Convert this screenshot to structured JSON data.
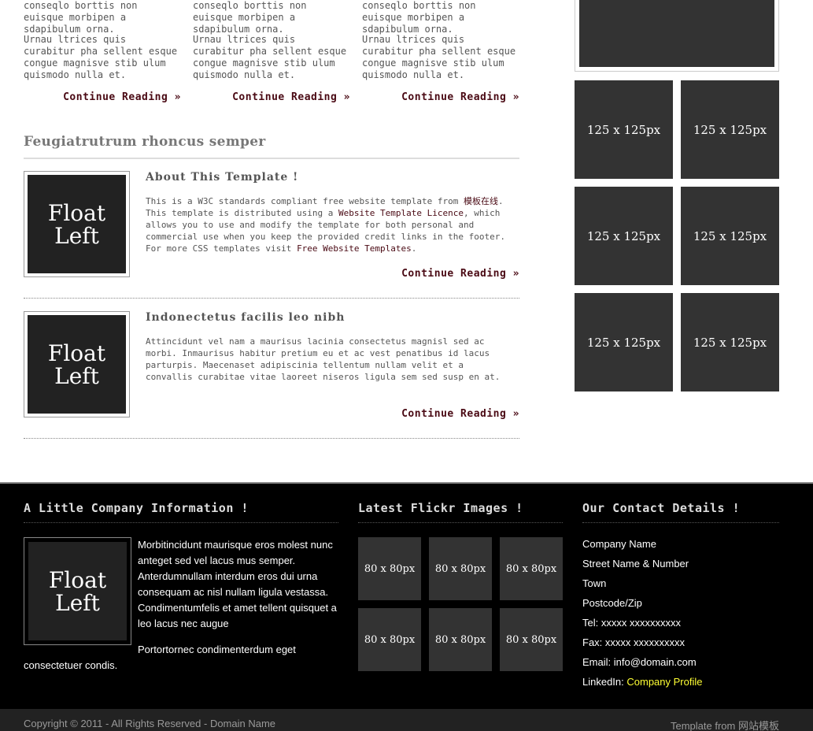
{
  "columns": [
    {
      "p1": "conseqlo borttis non euisque morbipen a sdapibulum orna.",
      "p2": "Urnau ltrices quis curabitur pha sellent esque congue magnisve stib ulum quismodo nulla et.",
      "more": "Continue Reading »"
    },
    {
      "p1": "conseqlo borttis non euisque morbipen a sdapibulum orna.",
      "p2": "Urnau ltrices quis curabitur pha sellent esque congue magnisve stib ulum quismodo nulla et.",
      "more": "Continue Reading »"
    },
    {
      "p1": "conseqlo borttis non euisque morbipen a sdapibulum orna.",
      "p2": "Urnau ltrices quis curabitur pha sellent esque congue magnisve stib ulum quismodo nulla et.",
      "more": "Continue Reading »"
    }
  ],
  "section_title": "Feugiatrutrum rhoncus semper",
  "posts": [
    {
      "thumb_line1": "Float",
      "thumb_line2": "Left",
      "title": "About This Template !",
      "t1": "This is a W3C standards compliant free website template from ",
      "link1": "模板在线",
      "t2": ". This template is distributed using a ",
      "link2": "Website Template Licence",
      "t3": ", which allows you to use and modify the template for both personal and commercial use when you keep the provided credit links in the footer. For more CSS templates visit ",
      "link3": "Free Website Templates",
      "t4": ".",
      "more": "Continue Reading »"
    },
    {
      "thumb_line1": "Float",
      "thumb_line2": "Left",
      "title": "Indonectetus facilis leo nibh",
      "body": "Attincidunt vel nam a maurisus lacinia consectetus magnisl sed ac morbi. Inmaurisus habitur pretium eu et ac vest penatibus id lacus parturpis. Maecenaset adipiscinia tellentum nullam velit et a convallis curabitae vitae laoreet niseros ligula sem sed susp en at.",
      "more": "Continue Reading »"
    }
  ],
  "sidebar": {
    "ads": [
      "125 x 125px",
      "125 x 125px",
      "125 x 125px",
      "125 x 125px",
      "125 x 125px",
      "125 x 125px"
    ]
  },
  "footer": {
    "company": {
      "heading": "A Little Company Information !",
      "thumb_line1": "Float",
      "thumb_line2": "Left",
      "p1": "Morbitincidunt maurisque eros molest nunc anteget sed vel lacus mus semper. Anterdumnullam interdum eros dui urna consequam ac nisl nullam ligula vestassa. Condimentumfelis et amet tellent quisquet a leo lacus nec augue",
      "p2a": "Portortornec condimenterdum eget",
      "p2b": "consectetuer condis."
    },
    "flickr": {
      "heading": "Latest Flickr Images !",
      "images": [
        "80 x 80px",
        "80 x 80px",
        "80 x 80px",
        "80 x 80px",
        "80 x 80px",
        "80 x 80px"
      ]
    },
    "contact": {
      "heading": "Our Contact Details !",
      "company_name": "Company Name",
      "street": "Street Name & Number",
      "town": "Town",
      "postcode": "Postcode/Zip",
      "tel": "Tel: xxxxx xxxxxxxxxx",
      "fax": "Fax: xxxxx xxxxxxxxxx",
      "email": "Email: info@domain.com",
      "linkedin_label": "LinkedIn: ",
      "linkedin_link": "Company Profile",
      "link_color": "#ffff33"
    }
  },
  "bottom": {
    "copyright": "Copyright © 2011 - All Rights Reserved - Domain Name",
    "template_from": "Template from ",
    "template_link": "网站模板"
  }
}
